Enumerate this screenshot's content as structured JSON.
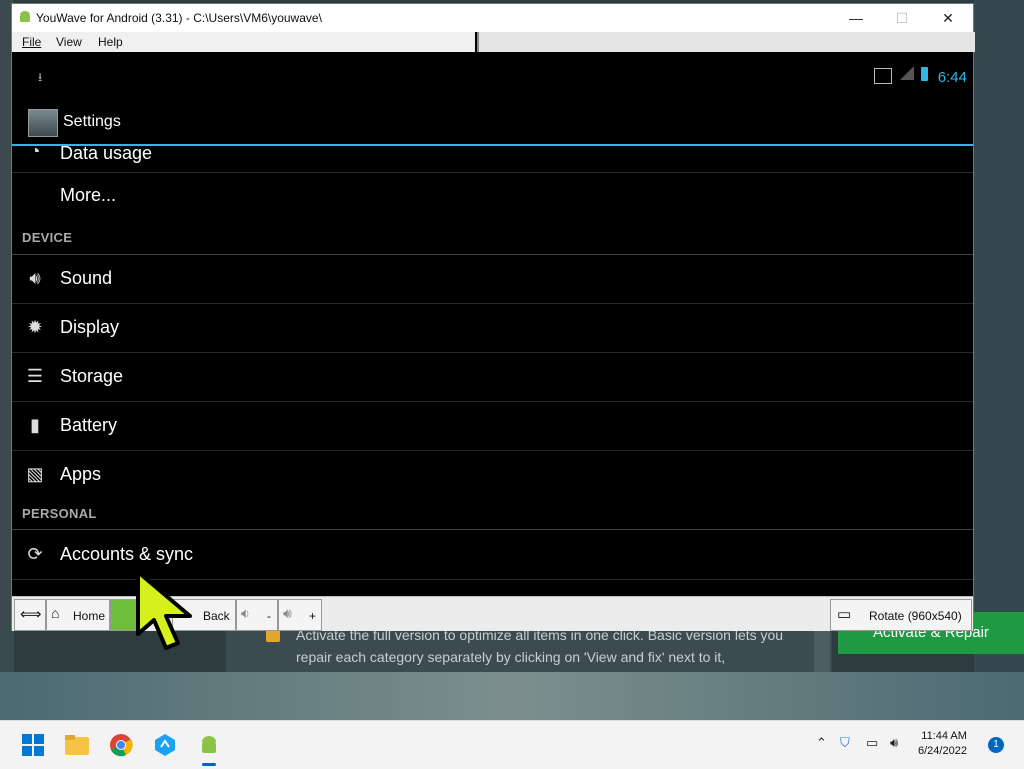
{
  "window": {
    "title": "YouWave for Android (3.31) - C:\\Users\\VM6\\youwave\\",
    "minimize": "—",
    "maximize": "☐",
    "close": "✕"
  },
  "menu": {
    "file": "File",
    "view": "View",
    "help": "Help"
  },
  "status": {
    "time": "6:44",
    "download_icon": "download-icon"
  },
  "actionbar": {
    "title": "Settings"
  },
  "list": {
    "data_usage": "Data usage",
    "more": "More...",
    "device_header": "DEVICE",
    "sound": "Sound",
    "display": "Display",
    "storage": "Storage",
    "battery": "Battery",
    "apps": "Apps",
    "personal_header": "PERSONAL",
    "accounts": "Accounts & sync"
  },
  "toolbar": {
    "home": "Home",
    "back": "Back",
    "vol_down": "-",
    "vol_up": "+",
    "rotate": "Rotate (960x540)"
  },
  "background_app": {
    "text": "Activate the full version to optimize all items in one click. Basic version lets you repair each category separately by clicking on 'View and fix' next to it,",
    "button": "Activate & Repair"
  },
  "taskbar": {
    "time": "11:44 AM",
    "date": "6/24/2022",
    "notifications": "1"
  },
  "colors": {
    "accent": "#33b5e5",
    "green": "#1f9a43",
    "cursor": "#d6f01e"
  }
}
